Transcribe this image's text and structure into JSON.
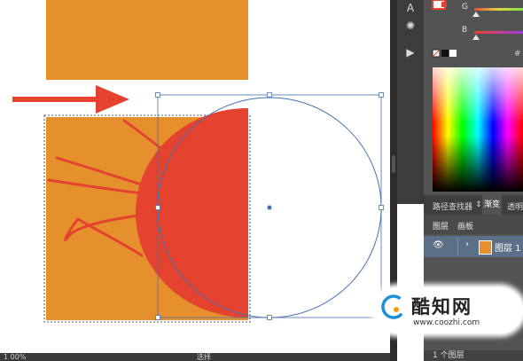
{
  "colors": {
    "orange": "#e5902d",
    "red": "#e4432f",
    "selection_blue": "#4a6fb0",
    "panel_bg": "#535353",
    "layer_highlight": "#5b6f86"
  },
  "canvas": {
    "arrow_icon": "arrow-right",
    "shapes": [
      "orange-rectangle-top",
      "orange-rectangle-bottom",
      "red-half-circle",
      "circle-outline",
      "red-strokes"
    ]
  },
  "status_bar": {
    "zoom": "1 00%",
    "mode_label": "选择"
  },
  "toolstrip": {
    "tools": [
      "type-icon",
      "gear-icon",
      "play-icon"
    ]
  },
  "color_panel": {
    "channel_g_label": "G",
    "channel_b_label": "B",
    "hash_label": "#"
  },
  "tabs": {
    "pathfinder_label": "路径查找器",
    "gradient_label": "渐变",
    "transparency_label": "透明"
  },
  "layers_panel": {
    "tab_layers_label": "图层",
    "tab_artboards_label": "画板",
    "layer_name": "图层 1",
    "footer_count": "1 个图层"
  },
  "watermark": {
    "site_name": "酷知网",
    "site_url": "www.coozhi.com"
  }
}
